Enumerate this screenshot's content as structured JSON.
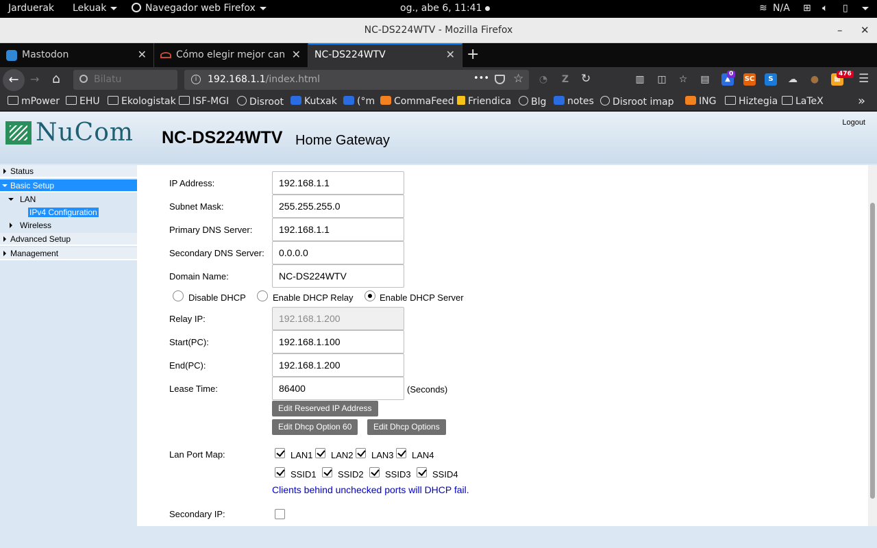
{
  "topbar": {
    "activities": "Jarduerak",
    "places": "Lekuak",
    "app": "Navegador web Firefox",
    "clock": "og., abe  6, 11:41",
    "network": "N/A"
  },
  "window": {
    "title": "NC-DS224WTV - Mozilla Firefox",
    "minimize": "–",
    "close": "✕"
  },
  "tabs": [
    {
      "label": "Mastodon"
    },
    {
      "label": "Cómo elegir mejor canal para"
    },
    {
      "label": "NC-DS224WTV"
    }
  ],
  "tab_close": "✕",
  "new_tab": "+",
  "nav": {
    "back": "←",
    "forward": "→",
    "home": "⌂",
    "search_placeholder": "Bilatu",
    "url_host": "192.168.1.1",
    "url_path": "/index.html",
    "more": "•••",
    "reload": "↻",
    "menu": "☰",
    "badge_a": "0",
    "badge_b": "476"
  },
  "bookmarks": [
    {
      "label": "mPower",
      "icon": "folder-icon"
    },
    {
      "label": "EHU",
      "icon": "folder-icon"
    },
    {
      "label": "Ekologistak",
      "icon": "folder-icon"
    },
    {
      "label": "ISF-MGI",
      "icon": "folder-icon"
    },
    {
      "label": "Disroot",
      "icon": "globe-icon"
    },
    {
      "label": "Kutxak",
      "icon": "nextcloud-icon"
    },
    {
      "label": "(°m",
      "icon": "mastodon-icon"
    },
    {
      "label": "CommaFeed",
      "icon": "rss-icon"
    },
    {
      "label": "Friendica",
      "icon": "friendica-icon"
    },
    {
      "label": "Blg",
      "icon": "blog-icon"
    },
    {
      "label": "notes",
      "icon": "nextcloud-icon"
    },
    {
      "label": "Disroot imap",
      "icon": "globe-icon"
    },
    {
      "label": "ING",
      "icon": "ing-icon"
    },
    {
      "label": "Hiztegia",
      "icon": "folder-icon"
    },
    {
      "label": "LaTeX",
      "icon": "folder-icon"
    }
  ],
  "bookmarks_overflow": "»",
  "router": {
    "brand": "NuCom",
    "model": "NC-DS224WTV",
    "subtitle": "Home Gateway",
    "logout": "Logout"
  },
  "sidebar": {
    "status": "Status",
    "basic_setup": "Basic Setup",
    "lan": "LAN",
    "ipv4": "IPv4 Configuration",
    "wireless": "Wireless",
    "advanced": "Advanced Setup",
    "management": "Management"
  },
  "form": {
    "ip_label": "IP Address:",
    "ip_value": "192.168.1.1",
    "mask_label": "Subnet Mask:",
    "mask_value": "255.255.255.0",
    "dns1_label": "Primary DNS Server:",
    "dns1_value": "192.168.1.1",
    "dns2_label": "Secondary DNS Server:",
    "dns2_value": "0.0.0.0",
    "domain_label": "Domain Name:",
    "domain_value": "NC-DS224WTV",
    "radio_disable": "Disable DHCP",
    "radio_relay": "Enable DHCP Relay",
    "radio_server": "Enable DHCP Server",
    "relay_label": "Relay IP:",
    "relay_value": "192.168.1.200",
    "start_label": "Start(PC):",
    "start_value": "192.168.1.100",
    "end_label": "End(PC):",
    "end_value": "192.168.1.200",
    "lease_label": "Lease Time:",
    "lease_value": "86400",
    "lease_unit": "(Seconds)",
    "btn_reserved": "Edit Reserved IP Address",
    "btn_opt60": "Edit Dhcp Option 60",
    "btn_options": "Edit Dhcp Options",
    "portmap_label": "Lan Port Map:",
    "ports_lan": [
      "LAN1",
      "LAN2",
      "LAN3",
      "LAN4"
    ],
    "ports_ssid": [
      "SSID1",
      "SSID2",
      "SSID3",
      "SSID4"
    ],
    "note": "Clients behind unchecked ports will DHCP fail.",
    "secondary_label": "Secondary IP:"
  }
}
